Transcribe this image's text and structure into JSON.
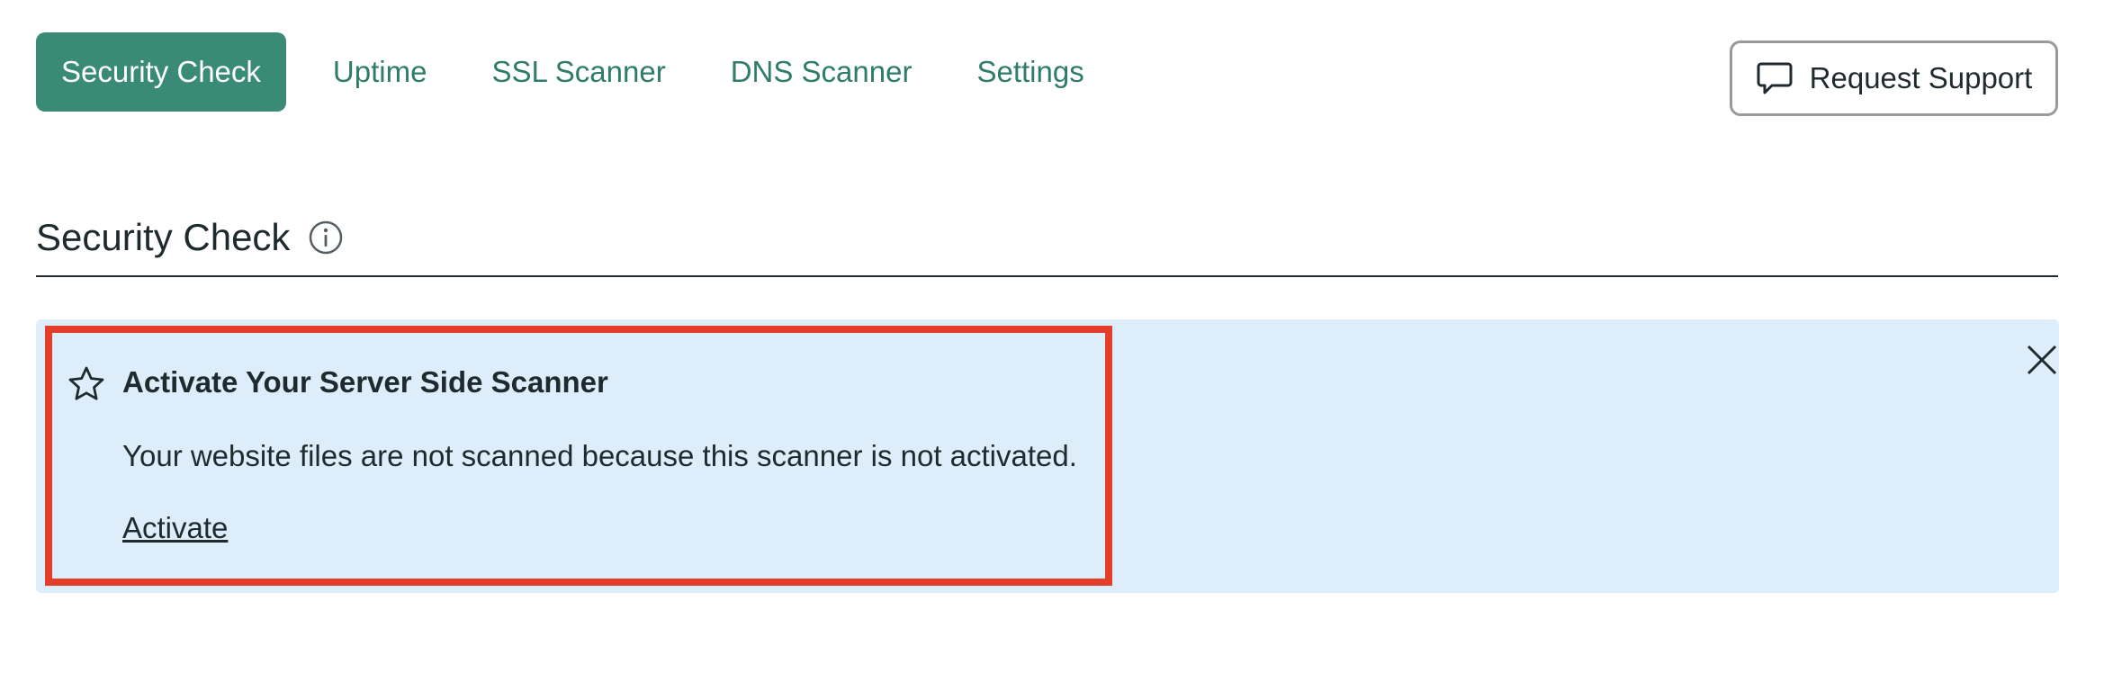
{
  "nav": {
    "tabs": [
      {
        "label": "Security Check",
        "active": true
      },
      {
        "label": "Uptime",
        "active": false
      },
      {
        "label": "SSL Scanner",
        "active": false
      },
      {
        "label": "DNS Scanner",
        "active": false
      },
      {
        "label": "Settings",
        "active": false
      }
    ]
  },
  "header": {
    "support_button_label": "Request Support",
    "support_icon": "chat-bubble-icon"
  },
  "section": {
    "title": "Security Check",
    "info_icon": "info-icon"
  },
  "notice": {
    "icon": "star-icon",
    "title": "Activate Your Server Side Scanner",
    "body": "Your website files are not scanned because this scanner is not activated.",
    "link_label": "Activate",
    "close_icon": "close-icon",
    "background_color": "#ddeefa",
    "highlight_color": "#e43e2b"
  },
  "colors": {
    "accent": "#3a8a78",
    "tab_text": "#2f7d68",
    "text": "#1f2a2e"
  }
}
